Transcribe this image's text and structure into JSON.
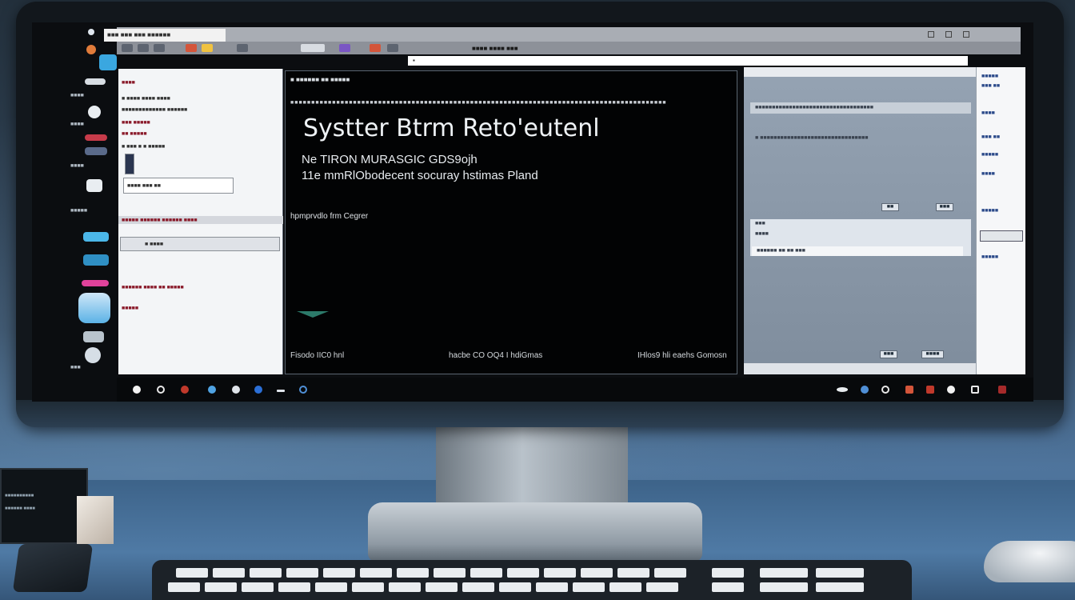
{
  "topbar": {
    "title": "■■■ ■■■ ■■■ ■■■■■■"
  },
  "menubar": {
    "labels": "■■■■ ■■■■ ■■■"
  },
  "addressbar": {
    "value": "▪"
  },
  "terminal": {
    "header": "■ ■■■■■■ ■■ ■■■■■",
    "title": "Systter  Btrm  Reto'eutenl",
    "line1": "Ne TIRON MURASGIC GDS9ojh",
    "line2": "11e mmRlObodecent  socuray  hstimas  Pland",
    "prompt": "hpmprvdlo frm Cegrer",
    "footer_left": "Fisodo IIC0 hnl",
    "footer_mid": "hacbe  CO  OQ4  I hdiGmas",
    "footer_right": "IHlos9 hli  eaehs  Gomosn"
  },
  "left_panel": {
    "line1": "■■■■",
    "line2": "■ ■■■■ ■■■■ ■■■■",
    "line3": "■■■■■■■■■■■■■ ■■■■■■",
    "line4": "■■■ ■■■■■",
    "line5": "■■ ■■■■■",
    "line6": "■ ■■■ ■ ■ ■■■■■",
    "row_a": "■■■■  ■■■  ■■",
    "row_b": "■■■■■ ■■■■■■  ■■■■■■ ■■■■",
    "row_c": "■ ■■■■",
    "line7": "■■■■■■ ■■■■ ■■ ■■■■■",
    "line8": "■■■■■"
  },
  "right_panel": {
    "strip1": "■■■■■■■■■■■■■■■■■■■■■■■■■■■■■■■■■■■",
    "strip2": "■ ■■■■■■■■■■■■■■■■■■■■■■■■■■■■■■■■",
    "btn1": "■■",
    "btn2": "■■■",
    "field1": "■■■",
    "field2": "■■■■",
    "field3": "■■■■■■ ■■ ■■ ■■■",
    "btn3": "■■■",
    "btn4": "■■■■"
  },
  "far_right": {
    "items": [
      "■■■■■",
      "■■■ ■■",
      "■■■■",
      "■■■ ■■",
      "■■■■■",
      "■■■■",
      "■■■■■",
      "■■■■■"
    ]
  },
  "dock": {
    "labels": [
      "■■■■",
      "■■■■",
      "■■■■",
      "■■■■■",
      "■■■",
      "■■■■■",
      "■■■■"
    ]
  },
  "side_device": {
    "line1": "■■■■■■■■■■",
    "line2": "■■■■■■ ■■■■"
  },
  "colors": {
    "accent_red": "#c0392b",
    "accent_blue": "#2b6fd6",
    "terminal_bg": "#020304"
  }
}
